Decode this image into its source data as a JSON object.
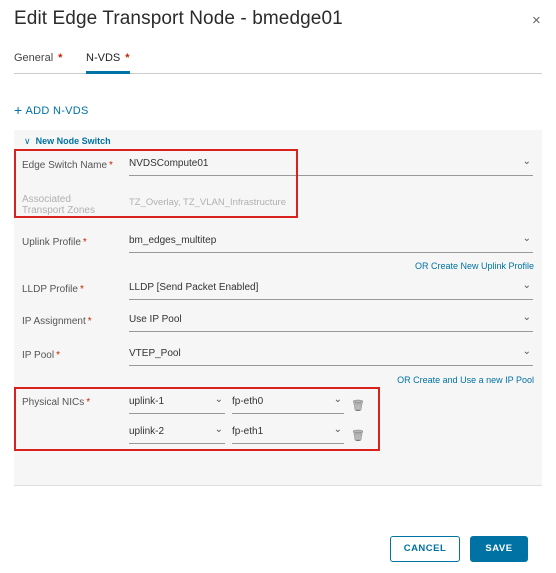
{
  "dialog": {
    "title": "Edit Edge Transport Node - bmedge01",
    "close_glyph": "×"
  },
  "tabs": [
    {
      "label": "General",
      "required": "*"
    },
    {
      "label": "N-VDS",
      "required": "*"
    }
  ],
  "add_nvds": {
    "icon": "+",
    "label": "ADD N-VDS"
  },
  "switch": {
    "header": "New Node Switch",
    "edge_switch_name": {
      "label": "Edge Switch Name",
      "required": "*",
      "value": "NVDSCompute01"
    },
    "transport_zones": {
      "label_line1": "Associated",
      "label_line2": "Transport Zones",
      "value": "TZ_Overlay, TZ_VLAN_Infrastructure"
    },
    "uplink_profile": {
      "label": "Uplink Profile",
      "required": "*",
      "value": "bm_edges_multitep",
      "link": "OR Create New Uplink Profile"
    },
    "lldp_profile": {
      "label": "LLDP Profile",
      "required": "*",
      "value": "LLDP [Send Packet Enabled]"
    },
    "ip_assignment": {
      "label": "IP Assignment",
      "required": "*",
      "value": "Use IP Pool"
    },
    "ip_pool": {
      "label": "IP Pool",
      "required": "*",
      "value": "VTEP_Pool",
      "link": "OR Create and Use a new IP Pool"
    },
    "physical_nics": {
      "label": "Physical NICs",
      "required": "*",
      "rows": [
        {
          "uplink": "uplink-1",
          "nic": "fp-eth0"
        },
        {
          "uplink": "uplink-2",
          "nic": "fp-eth1"
        }
      ]
    }
  },
  "footer": {
    "cancel": "CANCEL",
    "save": "SAVE"
  },
  "icons": {
    "caret": "⌄",
    "chevron": "∨",
    "trash": "🗑"
  },
  "colors": {
    "accent": "#0072a3",
    "required": "#c92100",
    "highlight": "#d9211e"
  }
}
